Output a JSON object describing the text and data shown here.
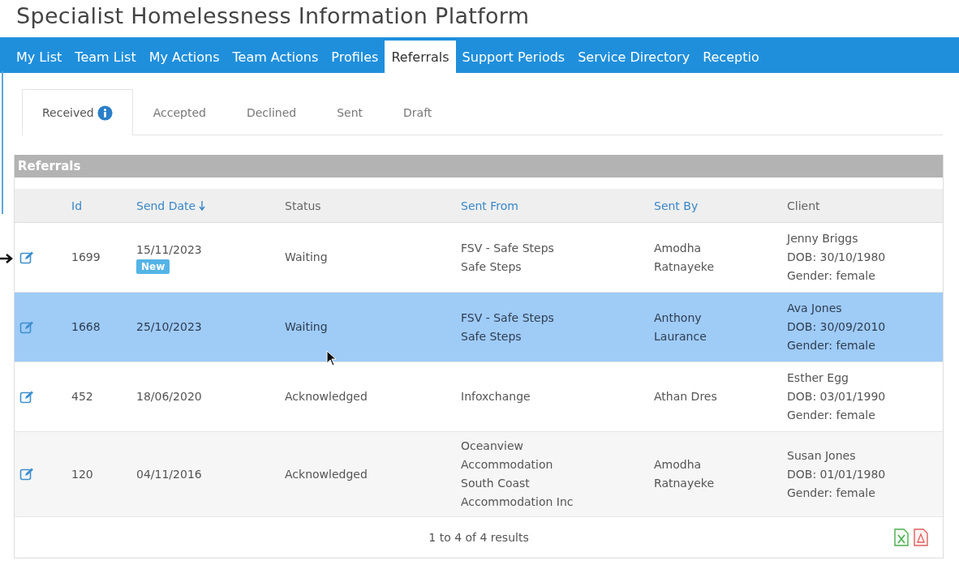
{
  "app_title": "Specialist Homelessness Information Platform",
  "nav": [
    {
      "label": "My List",
      "selected": false
    },
    {
      "label": "Team List",
      "selected": false
    },
    {
      "label": "My Actions",
      "selected": false
    },
    {
      "label": "Team Actions",
      "selected": false
    },
    {
      "label": "Profiles",
      "selected": false
    },
    {
      "label": "Referrals",
      "selected": true
    },
    {
      "label": "Support Periods",
      "selected": false
    },
    {
      "label": "Service Directory",
      "selected": false
    },
    {
      "label": "Receptio",
      "selected": false
    }
  ],
  "tabs": [
    {
      "label": "Received",
      "selected": true,
      "info": true
    },
    {
      "label": "Accepted",
      "selected": false,
      "info": false
    },
    {
      "label": "Declined",
      "selected": false,
      "info": false
    },
    {
      "label": "Sent",
      "selected": false,
      "info": false
    },
    {
      "label": "Draft",
      "selected": false,
      "info": false
    }
  ],
  "panel": {
    "title": "Referrals",
    "columns": [
      "Id",
      "Send Date",
      "Status",
      "Sent From",
      "Sent By",
      "Client"
    ],
    "rows": [
      {
        "selected": false,
        "id": "1699",
        "send_date": "15/11/2023",
        "badge": "New",
        "status": "Waiting",
        "sent_from": [
          "FSV - Safe Steps",
          "Safe Steps"
        ],
        "sent_by": [
          "Amodha",
          "Ratnayeke"
        ],
        "client": [
          "Jenny Briggs",
          "DOB: 30/10/1980",
          "Gender: female"
        ]
      },
      {
        "selected": true,
        "id": "1668",
        "send_date": "25/10/2023",
        "status": "Waiting",
        "sent_from": [
          "FSV - Safe Steps",
          "Safe Steps"
        ],
        "sent_by": [
          "Anthony",
          "Laurance"
        ],
        "client": [
          "Ava Jones",
          "DOB: 30/09/2010",
          "Gender: female"
        ]
      },
      {
        "selected": false,
        "id": "452",
        "send_date": "18/06/2020",
        "status": "Acknowledged",
        "sent_from": [
          "Infoxchange"
        ],
        "sent_by": [
          "Athan Dres"
        ],
        "client": [
          "Esther Egg",
          "DOB: 03/01/1990",
          "Gender: female"
        ]
      },
      {
        "selected": false,
        "id": "120",
        "send_date": "04/11/2016",
        "status": "Acknowledged",
        "sent_from": [
          "Oceanview",
          "Accommodation",
          "South Coast",
          "Accommodation Inc"
        ],
        "sent_by": [
          "Amodha",
          "Ratnayeke"
        ],
        "client": [
          "Susan Jones",
          "DOB: 01/01/1980",
          "Gender: female"
        ]
      }
    ],
    "results": "1 to 4 of 4 results"
  }
}
